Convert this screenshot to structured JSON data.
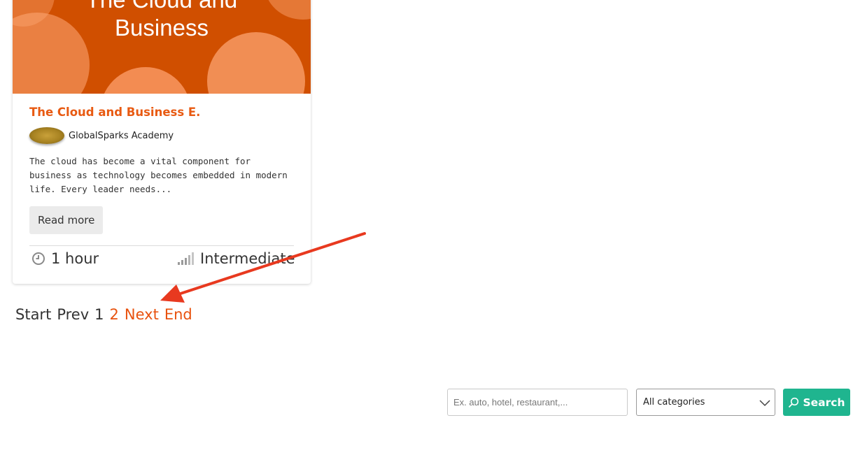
{
  "course_card": {
    "banner_title": "The Cloud and\nBusiness",
    "title": "The Cloud and Business E.",
    "author": "GlobalSparks Academy",
    "description": "The cloud has become a vital component for business as technology becomes embedded in modern life. Every leader needs...",
    "read_more_label": "Read more",
    "duration_icon": "clock-icon",
    "duration": "1 hour",
    "level_icon": "signal-bars-icon",
    "level": "Intermediate",
    "banner_color": "#d04f00",
    "title_color": "#e85a12"
  },
  "pagination": {
    "start": "Start",
    "prev": "Prev",
    "page1": "1",
    "page2": "2",
    "next": "Next",
    "end": "End",
    "active_color": "#e8520e"
  },
  "search": {
    "placeholder": "Ex. auto, hotel, restaurant,...",
    "category_selected": "All categories",
    "button_label": "Search",
    "button_icon": "search-icon",
    "button_color": "#1fb58f"
  },
  "annotation": {
    "arrow_color": "#e8391f"
  }
}
